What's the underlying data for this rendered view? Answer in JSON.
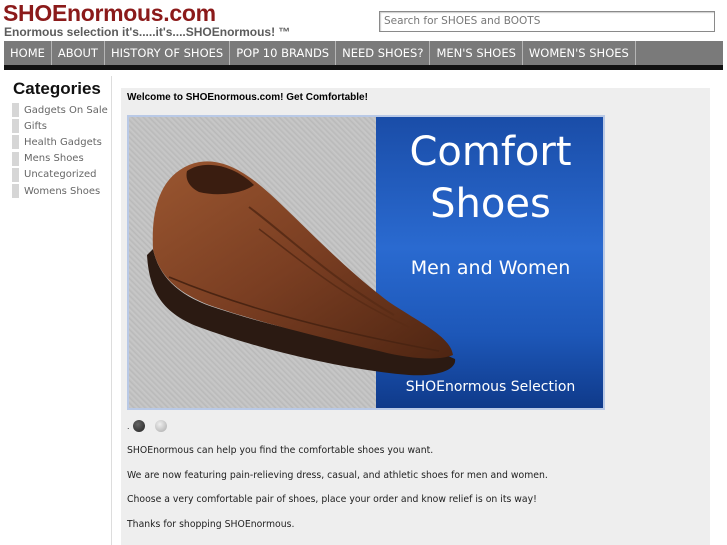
{
  "header": {
    "site_title": "SHOEnormous.com",
    "tagline": "Enormous selection it's.....it's....SHOEnormous! ™",
    "search_placeholder": "Search for SHOES and BOOTS"
  },
  "nav": {
    "items": [
      {
        "label": "HOME"
      },
      {
        "label": "ABOUT"
      },
      {
        "label": "HISTORY OF SHOES"
      },
      {
        "label": "POP 10 BRANDS"
      },
      {
        "label": "NEED SHOES?"
      },
      {
        "label": "MEN'S SHOES"
      },
      {
        "label": "WOMEN'S SHOES"
      }
    ]
  },
  "sidebar": {
    "title": "Categories",
    "categories": [
      {
        "label": "Gadgets On Sale"
      },
      {
        "label": "Gifts"
      },
      {
        "label": "Health Gadgets"
      },
      {
        "label": "Mens Shoes"
      },
      {
        "label": "Uncategorized"
      },
      {
        "label": "Womens Shoes"
      }
    ]
  },
  "main": {
    "welcome": "Welcome to SHOEnormous.com! Get Comfortable!",
    "banner": {
      "line1": "Comfort",
      "line2": "Shoes",
      "line3": "Men and Women",
      "line4": "SHOEnormous Selection"
    },
    "slider": {
      "prefix": ".",
      "slide_count": 2,
      "active_index": 0
    },
    "paragraphs": [
      "SHOEnormous can help you find the comfortable shoes you want.",
      "We are now featuring pain-relieving dress, casual, and athletic shoes for men and women.",
      "Choose a very comfortable pair of shoes, place your order and know relief is on its way!",
      "Thanks for shopping SHOEnormous."
    ]
  },
  "colors": {
    "title": "#8b1a1a",
    "nav_bg": "#7a7a7a",
    "banner_blue": "#1d57b8",
    "shoe_brown": "#7a3e22"
  }
}
